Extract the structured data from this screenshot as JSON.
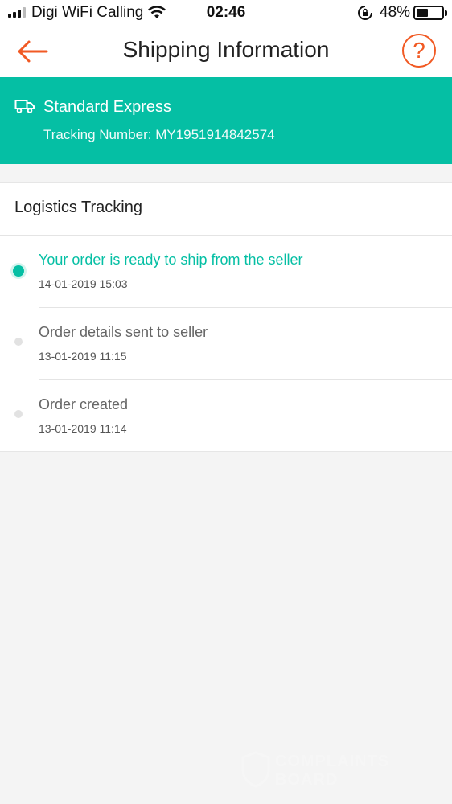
{
  "status_bar": {
    "carrier": "Digi WiFi Calling",
    "time": "02:46",
    "battery_percent": "48%",
    "battery_level": 0.48
  },
  "nav": {
    "title": "Shipping Information",
    "help_label": "?"
  },
  "shipment": {
    "method": "Standard Express",
    "tracking_label": "Tracking Number: MY1951914842574"
  },
  "logistics": {
    "title": "Logistics Tracking",
    "events": [
      {
        "title": "Your order is ready to ship from the seller",
        "time": "14-01-2019 15:03",
        "active": true
      },
      {
        "title": "Order details sent to seller",
        "time": "13-01-2019 11:15",
        "active": false
      },
      {
        "title": "Order created",
        "time": "13-01-2019 11:14",
        "active": false
      }
    ]
  },
  "colors": {
    "accent": "#05bfa4",
    "back_arrow": "#f15a24"
  }
}
